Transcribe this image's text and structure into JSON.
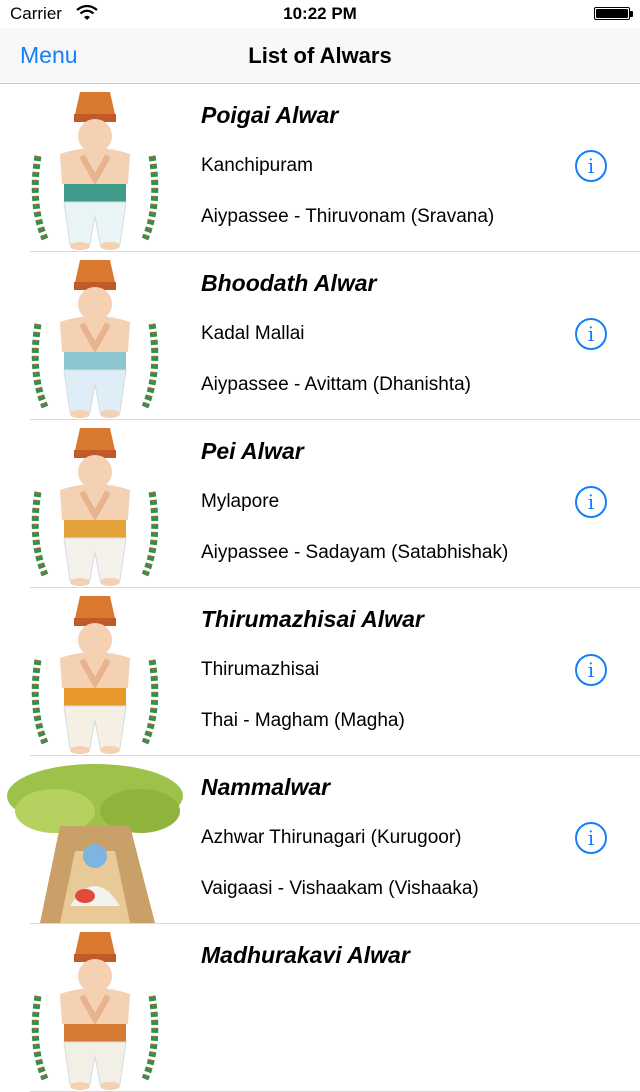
{
  "status_bar": {
    "carrier": "Carrier",
    "time": "10:22 PM",
    "wifi_icon": "wifi-icon",
    "battery_icon": "battery-icon",
    "battery_level": 1.0
  },
  "nav": {
    "menu_label": "Menu",
    "title": "List of Alwars"
  },
  "accent_color": "#157efb",
  "alwars": [
    {
      "name": "Poigai Alwar",
      "place": "Kanchipuram",
      "star": "Aiypassee - Thiruvonam (Sravana)",
      "icon": "info-icon"
    },
    {
      "name": "Bhoodath Alwar",
      "place": "Kadal Mallai",
      "star": "Aiypassee - Avittam (Dhanishta)",
      "icon": "info-icon"
    },
    {
      "name": "Pei Alwar",
      "place": "Mylapore",
      "star": "Aiypassee - Sadayam (Satabhishak)",
      "icon": "info-icon"
    },
    {
      "name": "Thirumazhisai Alwar",
      "place": "Thirumazhisai",
      "star": "Thai - Magham (Magha)",
      "icon": "info-icon"
    },
    {
      "name": "Nammalwar",
      "place": "Azhwar Thirunagari (Kurugoor)",
      "star": "Vaigaasi - Vishaakam (Vishaaka)",
      "icon": "info-icon"
    },
    {
      "name": "Madhurakavi Alwar"
    }
  ]
}
